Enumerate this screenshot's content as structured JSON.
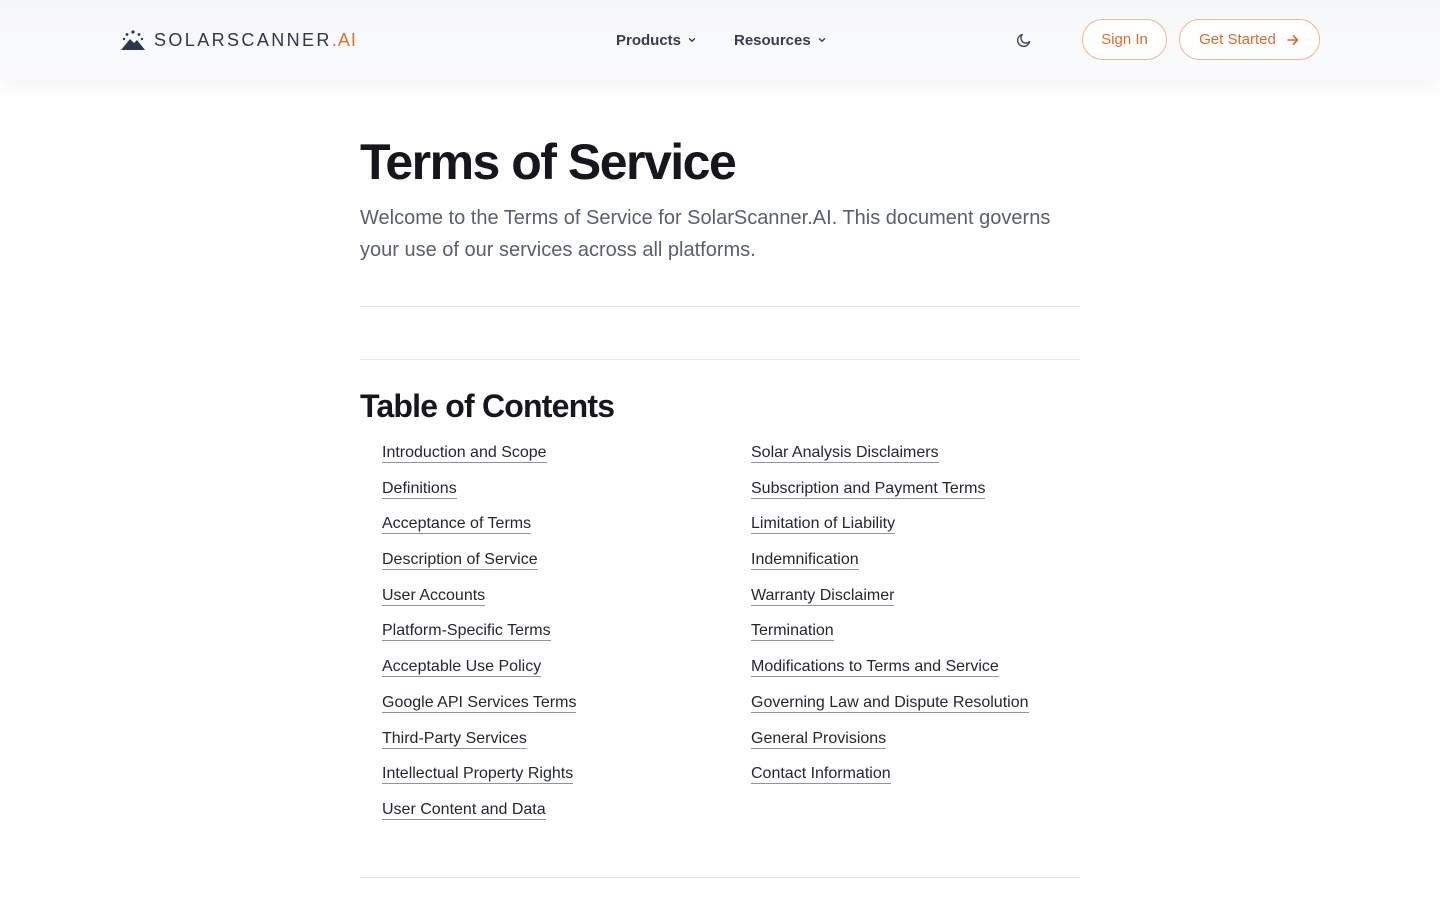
{
  "header": {
    "logo": {
      "text": "SOLARSCANNER",
      "suffix": ".AI",
      "icon": "sun-mountain-icon"
    },
    "nav": [
      {
        "label": "Products",
        "icon": "chevron-down-icon"
      },
      {
        "label": "Resources",
        "icon": "chevron-down-icon"
      }
    ],
    "theme_toggle_icon": "moon-icon",
    "sign_in_label": "Sign In",
    "get_started_label": "Get Started",
    "get_started_icon": "arrow-right-icon"
  },
  "colors": {
    "accent": "#e8702e",
    "text": "#15171d",
    "muted": "#5a5f6e",
    "logo": "#2e3650"
  },
  "main": {
    "title": "Terms of Service",
    "intro": "Welcome to the Terms of Service for SolarScanner.AI. This document governs your use of our services across all platforms."
  },
  "toc": {
    "title": "Table of Contents",
    "left": [
      "Introduction and Scope",
      "Definitions",
      "Acceptance of Terms",
      "Description of Service",
      "User Accounts",
      "Platform-Specific Terms",
      "Acceptable Use Policy",
      "Google API Services Terms",
      "Third-Party Services",
      "Intellectual Property Rights",
      "User Content and Data"
    ],
    "right": [
      "Solar Analysis Disclaimers",
      "Subscription and Payment Terms",
      "Limitation of Liability",
      "Indemnification",
      "Warranty Disclaimer",
      "Termination",
      "Modifications to Terms and Service",
      "Governing Law and Dispute Resolution",
      "General Provisions",
      "Contact Information"
    ]
  }
}
